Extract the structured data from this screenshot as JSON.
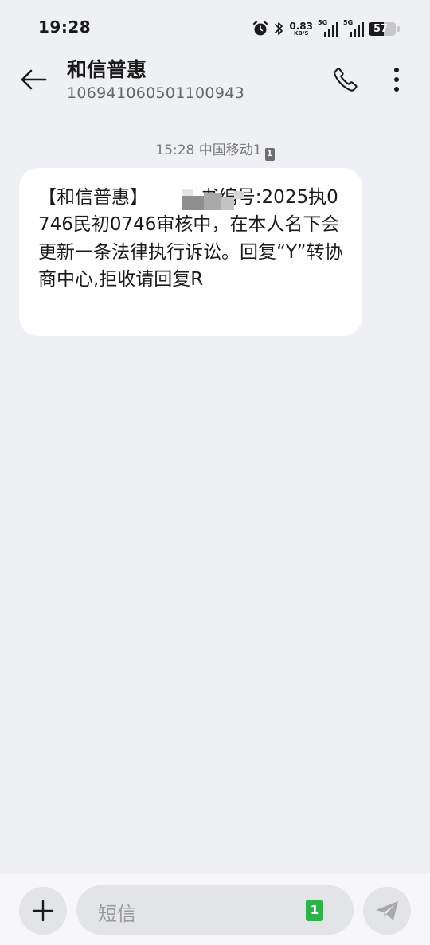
{
  "status_bar": {
    "time": "19:28",
    "net_speed_value": "0.83",
    "net_speed_unit": "KB/S",
    "sim1_tag": "5G",
    "sim2_tag": "5G",
    "battery_level": "57",
    "battery_percent": 57,
    "icons": [
      "alarm-icon",
      "bluetooth-icon",
      "signal-icon",
      "battery-icon"
    ]
  },
  "header": {
    "contact_name": "和信普惠",
    "contact_number": "106941060501100943",
    "icons": [
      "back-arrow-icon",
      "phone-icon",
      "more-vertical-icon"
    ]
  },
  "conversation": {
    "timestamp": "15:28",
    "carrier": "中国移动1",
    "sim_slot": "1",
    "message": "【和信普惠】         书编号:2025执0746民初0746审核中，在本人名下会更新一条法律执行诉讼。回复“Y”转协商中心,拒收请回复R"
  },
  "composer": {
    "placeholder": "短信",
    "sim_slot": "1",
    "icons": [
      "plus-icon",
      "send-icon"
    ]
  },
  "colors": {
    "background": "#eff0f4",
    "bubble": "#ffffff",
    "sim_badge": "#2fb24a",
    "text": "#1a1a1a",
    "secondary_text": "#7a7a7a"
  }
}
